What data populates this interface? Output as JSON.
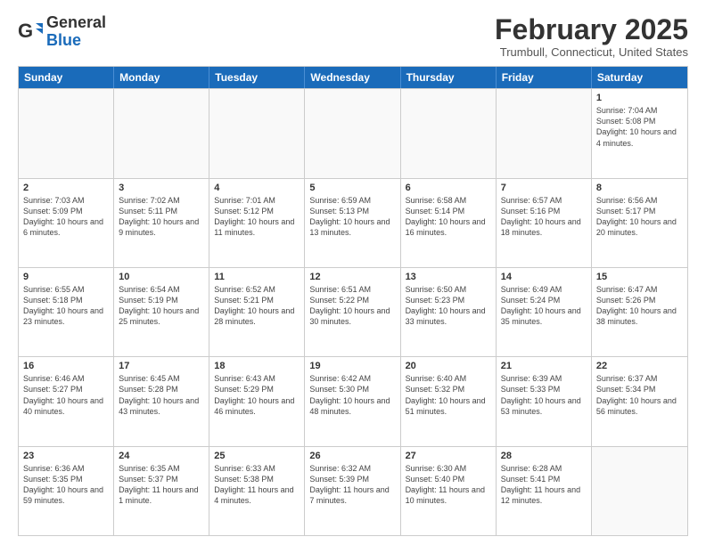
{
  "header": {
    "logo_general": "General",
    "logo_blue": "Blue",
    "month_title": "February 2025",
    "subtitle": "Trumbull, Connecticut, United States"
  },
  "days_of_week": [
    "Sunday",
    "Monday",
    "Tuesday",
    "Wednesday",
    "Thursday",
    "Friday",
    "Saturday"
  ],
  "weeks": [
    [
      {
        "day": "",
        "info": ""
      },
      {
        "day": "",
        "info": ""
      },
      {
        "day": "",
        "info": ""
      },
      {
        "day": "",
        "info": ""
      },
      {
        "day": "",
        "info": ""
      },
      {
        "day": "",
        "info": ""
      },
      {
        "day": "1",
        "info": "Sunrise: 7:04 AM\nSunset: 5:08 PM\nDaylight: 10 hours and 4 minutes."
      }
    ],
    [
      {
        "day": "2",
        "info": "Sunrise: 7:03 AM\nSunset: 5:09 PM\nDaylight: 10 hours and 6 minutes."
      },
      {
        "day": "3",
        "info": "Sunrise: 7:02 AM\nSunset: 5:11 PM\nDaylight: 10 hours and 9 minutes."
      },
      {
        "day": "4",
        "info": "Sunrise: 7:01 AM\nSunset: 5:12 PM\nDaylight: 10 hours and 11 minutes."
      },
      {
        "day": "5",
        "info": "Sunrise: 6:59 AM\nSunset: 5:13 PM\nDaylight: 10 hours and 13 minutes."
      },
      {
        "day": "6",
        "info": "Sunrise: 6:58 AM\nSunset: 5:14 PM\nDaylight: 10 hours and 16 minutes."
      },
      {
        "day": "7",
        "info": "Sunrise: 6:57 AM\nSunset: 5:16 PM\nDaylight: 10 hours and 18 minutes."
      },
      {
        "day": "8",
        "info": "Sunrise: 6:56 AM\nSunset: 5:17 PM\nDaylight: 10 hours and 20 minutes."
      }
    ],
    [
      {
        "day": "9",
        "info": "Sunrise: 6:55 AM\nSunset: 5:18 PM\nDaylight: 10 hours and 23 minutes."
      },
      {
        "day": "10",
        "info": "Sunrise: 6:54 AM\nSunset: 5:19 PM\nDaylight: 10 hours and 25 minutes."
      },
      {
        "day": "11",
        "info": "Sunrise: 6:52 AM\nSunset: 5:21 PM\nDaylight: 10 hours and 28 minutes."
      },
      {
        "day": "12",
        "info": "Sunrise: 6:51 AM\nSunset: 5:22 PM\nDaylight: 10 hours and 30 minutes."
      },
      {
        "day": "13",
        "info": "Sunrise: 6:50 AM\nSunset: 5:23 PM\nDaylight: 10 hours and 33 minutes."
      },
      {
        "day": "14",
        "info": "Sunrise: 6:49 AM\nSunset: 5:24 PM\nDaylight: 10 hours and 35 minutes."
      },
      {
        "day": "15",
        "info": "Sunrise: 6:47 AM\nSunset: 5:26 PM\nDaylight: 10 hours and 38 minutes."
      }
    ],
    [
      {
        "day": "16",
        "info": "Sunrise: 6:46 AM\nSunset: 5:27 PM\nDaylight: 10 hours and 40 minutes."
      },
      {
        "day": "17",
        "info": "Sunrise: 6:45 AM\nSunset: 5:28 PM\nDaylight: 10 hours and 43 minutes."
      },
      {
        "day": "18",
        "info": "Sunrise: 6:43 AM\nSunset: 5:29 PM\nDaylight: 10 hours and 46 minutes."
      },
      {
        "day": "19",
        "info": "Sunrise: 6:42 AM\nSunset: 5:30 PM\nDaylight: 10 hours and 48 minutes."
      },
      {
        "day": "20",
        "info": "Sunrise: 6:40 AM\nSunset: 5:32 PM\nDaylight: 10 hours and 51 minutes."
      },
      {
        "day": "21",
        "info": "Sunrise: 6:39 AM\nSunset: 5:33 PM\nDaylight: 10 hours and 53 minutes."
      },
      {
        "day": "22",
        "info": "Sunrise: 6:37 AM\nSunset: 5:34 PM\nDaylight: 10 hours and 56 minutes."
      }
    ],
    [
      {
        "day": "23",
        "info": "Sunrise: 6:36 AM\nSunset: 5:35 PM\nDaylight: 10 hours and 59 minutes."
      },
      {
        "day": "24",
        "info": "Sunrise: 6:35 AM\nSunset: 5:37 PM\nDaylight: 11 hours and 1 minute."
      },
      {
        "day": "25",
        "info": "Sunrise: 6:33 AM\nSunset: 5:38 PM\nDaylight: 11 hours and 4 minutes."
      },
      {
        "day": "26",
        "info": "Sunrise: 6:32 AM\nSunset: 5:39 PM\nDaylight: 11 hours and 7 minutes."
      },
      {
        "day": "27",
        "info": "Sunrise: 6:30 AM\nSunset: 5:40 PM\nDaylight: 11 hours and 10 minutes."
      },
      {
        "day": "28",
        "info": "Sunrise: 6:28 AM\nSunset: 5:41 PM\nDaylight: 11 hours and 12 minutes."
      },
      {
        "day": "",
        "info": ""
      }
    ]
  ]
}
